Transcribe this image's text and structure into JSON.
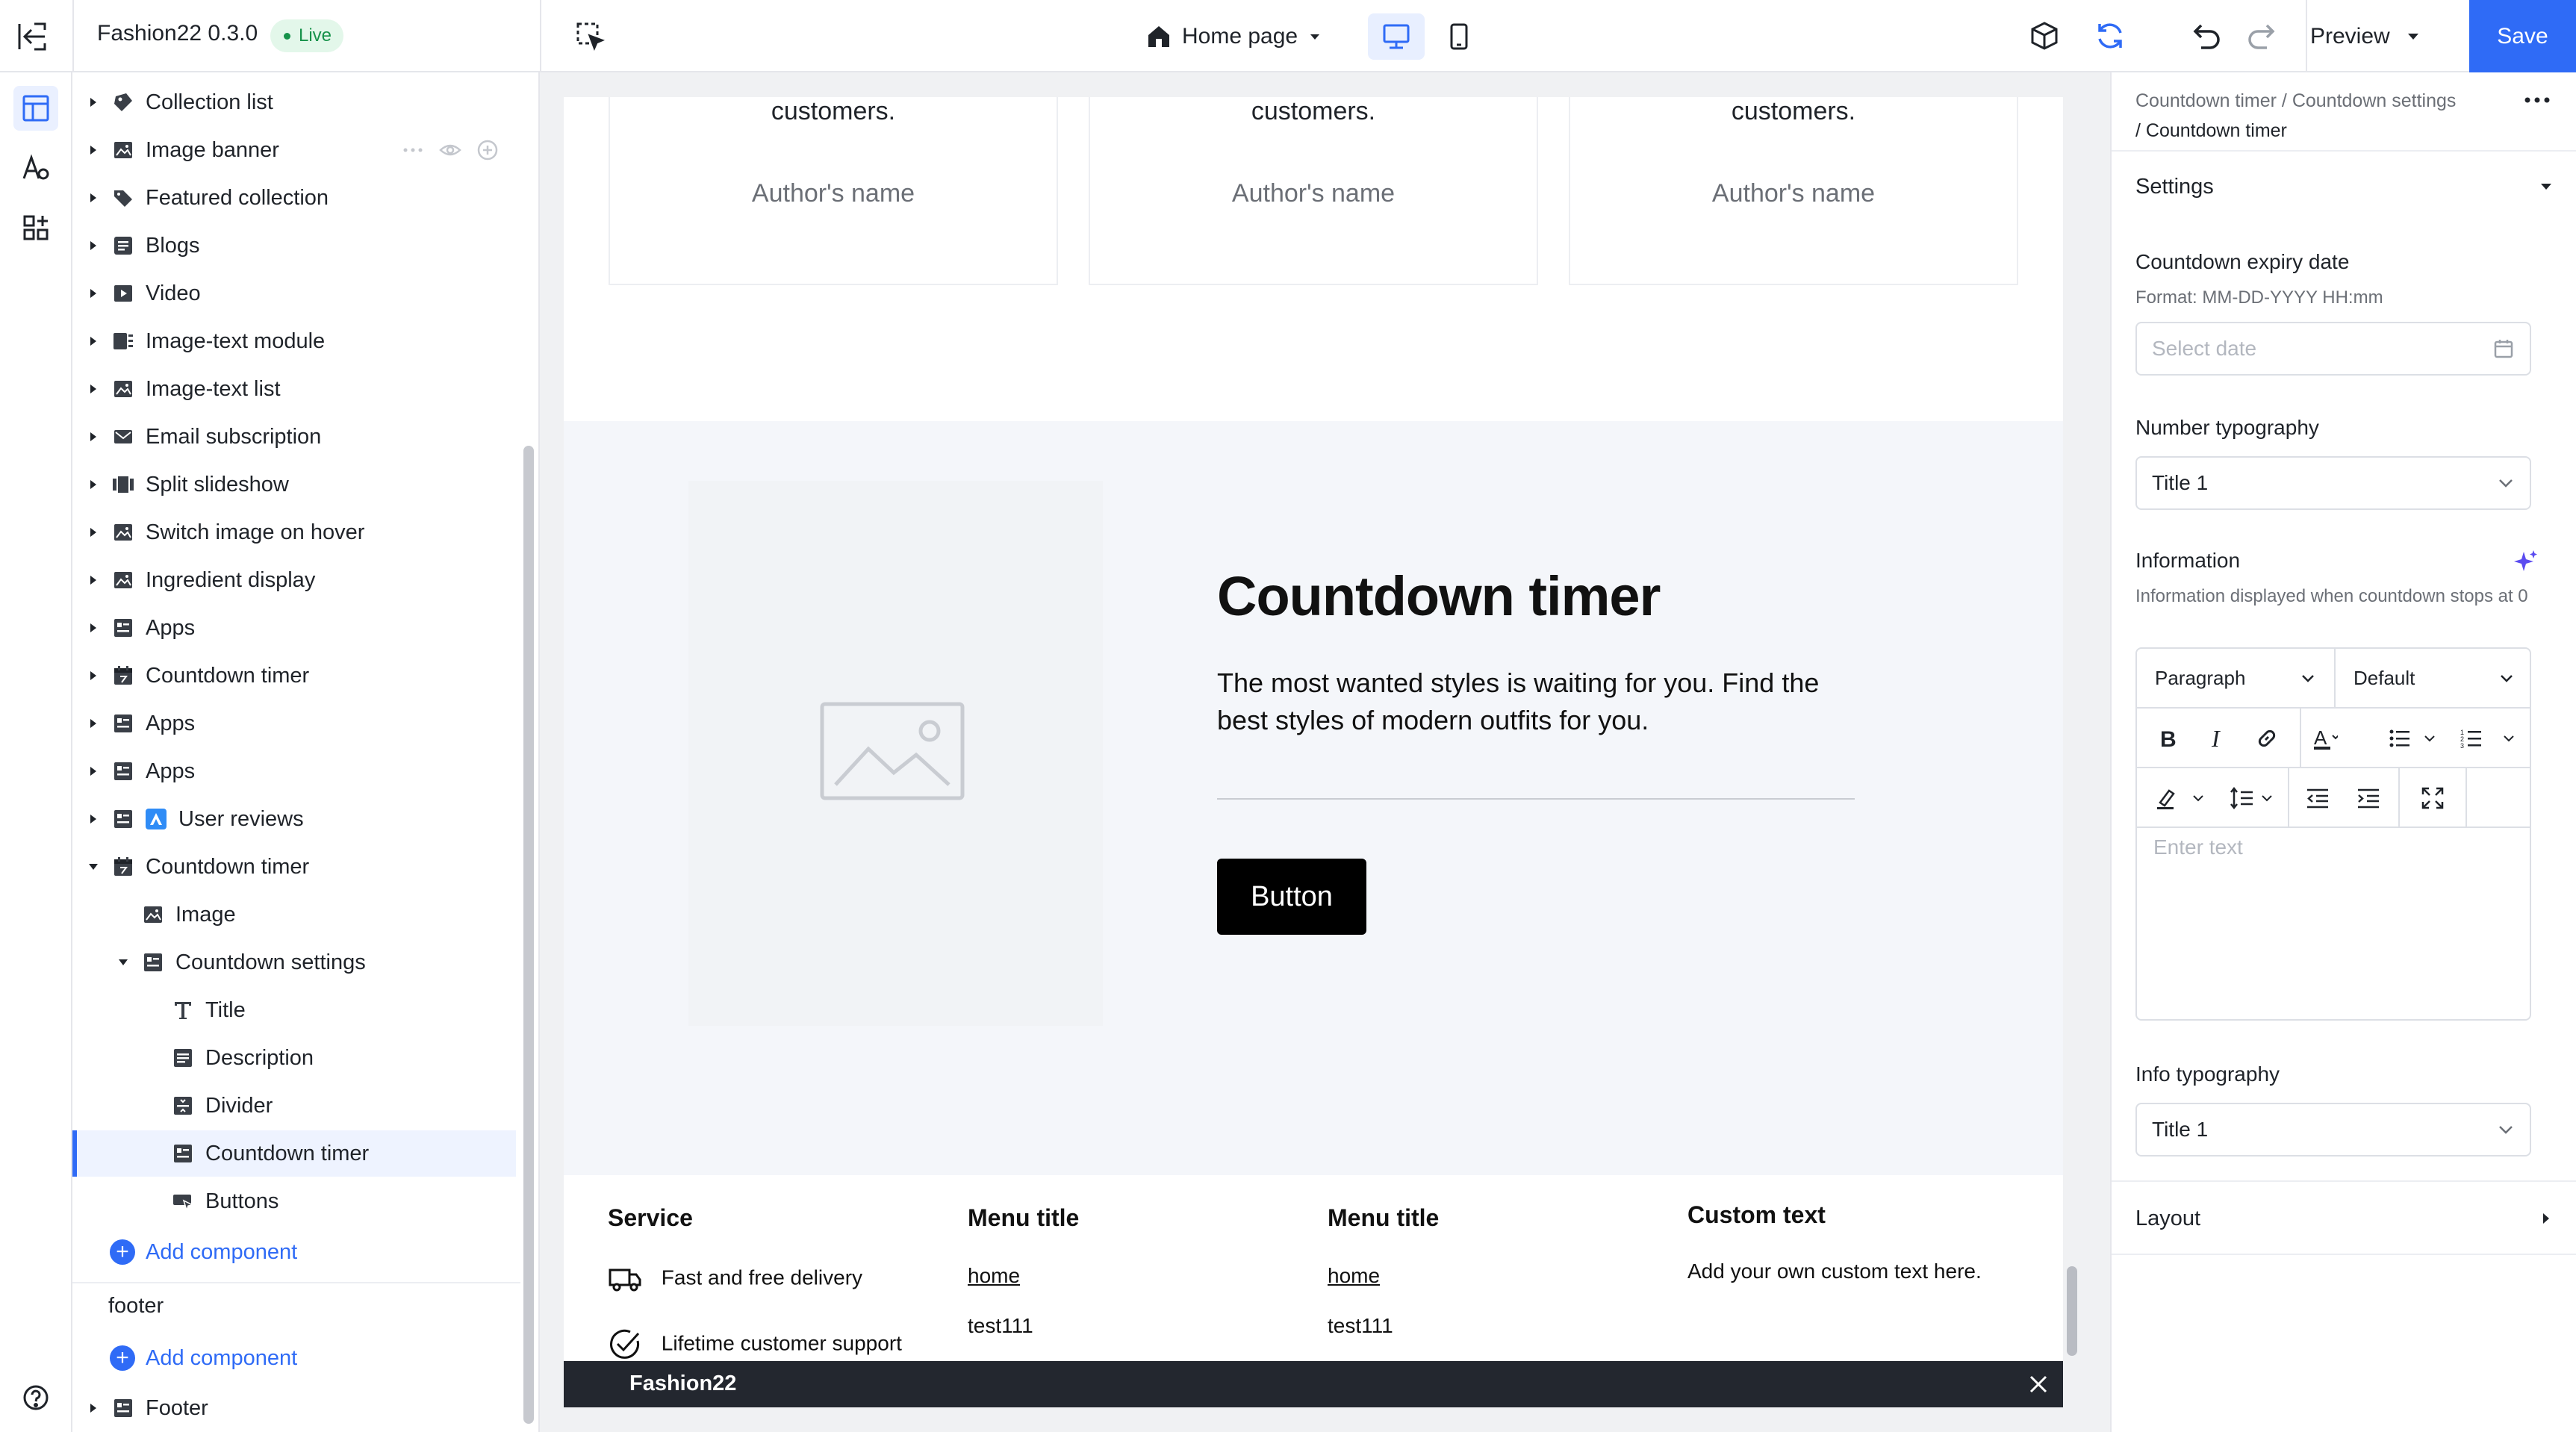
{
  "header": {
    "app_name": "Fashion22 0.3.0",
    "status_badge": "Live",
    "page_selector": "Home page",
    "preview_label": "Preview",
    "save_label": "Save",
    "colors": {
      "accent": "#2f6bf6",
      "live": "#16924a"
    }
  },
  "layers": {
    "items": [
      {
        "label": "Collection list",
        "icon": "collection-icon"
      },
      {
        "label": "Image banner",
        "icon": "image-icon"
      },
      {
        "label": "Featured collection",
        "icon": "tag-icon"
      },
      {
        "label": "Blogs",
        "icon": "blog-icon"
      },
      {
        "label": "Video",
        "icon": "video-icon"
      },
      {
        "label": "Image-text module",
        "icon": "image-text-icon"
      },
      {
        "label": "Image-text list",
        "icon": "image-icon"
      },
      {
        "label": "Email subscription",
        "icon": "email-icon"
      },
      {
        "label": "Split slideshow",
        "icon": "slideshow-icon"
      },
      {
        "label": "Switch image on hover",
        "icon": "image-icon"
      },
      {
        "label": "Ingredient display",
        "icon": "image-icon"
      },
      {
        "label": "Apps",
        "icon": "app-icon"
      },
      {
        "label": "Countdown timer",
        "icon": "calendar-icon"
      },
      {
        "label": "Apps",
        "icon": "app-icon"
      },
      {
        "label": "Apps",
        "icon": "app-icon"
      },
      {
        "label": "User reviews",
        "icon": "app-icon"
      },
      {
        "label": "Countdown timer",
        "icon": "calendar-icon"
      },
      {
        "label": "Image",
        "icon": "image-icon"
      },
      {
        "label": "Countdown settings",
        "icon": "app-icon"
      },
      {
        "label": "Title",
        "icon": "text-icon"
      },
      {
        "label": "Description",
        "icon": "paragraph-icon"
      },
      {
        "label": "Divider",
        "icon": "divider-icon"
      },
      {
        "label": "Countdown timer",
        "icon": "app-icon"
      },
      {
        "label": "Buttons",
        "icon": "button-icon"
      }
    ],
    "add_component": "Add component",
    "footer_group": "footer",
    "footer_item": "Footer"
  },
  "canvas": {
    "testimonials": [
      {
        "quote": "customers.",
        "author": "Author's name"
      },
      {
        "quote": "customers.",
        "author": "Author's name"
      },
      {
        "quote": "customers.",
        "author": "Author's name"
      }
    ],
    "countdown": {
      "title": "Countdown timer",
      "description": "The most wanted styles is waiting for you. Find the best styles of modern outfits for you.",
      "button": "Button"
    },
    "footer": {
      "service_title": "Service",
      "service_items": [
        "Fast and free delivery",
        "Lifetime customer support"
      ],
      "menu1_title": "Menu title",
      "menu1_links": [
        "home",
        "test111"
      ],
      "menu2_title": "Menu title",
      "menu2_links": [
        "home",
        "test111"
      ],
      "custom_title": "Custom text",
      "custom_body": "Add your own custom text here."
    },
    "bottom_bar": "Fashion22"
  },
  "settings": {
    "breadcrumb_path": "Countdown timer / Countdown settings",
    "breadcrumb_current": "/ Countdown timer",
    "section_title": "Settings",
    "expiry_label": "Countdown expiry date",
    "expiry_hint": "Format: MM-DD-YYYY HH:mm",
    "expiry_placeholder": "Select date",
    "number_typo_label": "Number typography",
    "number_typo_value": "Title 1",
    "info_label": "Information",
    "info_hint": "Information displayed when countdown stops at 0",
    "editor_block_format": "Paragraph",
    "editor_font": "Default",
    "editor_placeholder": "Enter text",
    "info_typo_label": "Info typography",
    "info_typo_value": "Title 1",
    "layout_label": "Layout"
  }
}
